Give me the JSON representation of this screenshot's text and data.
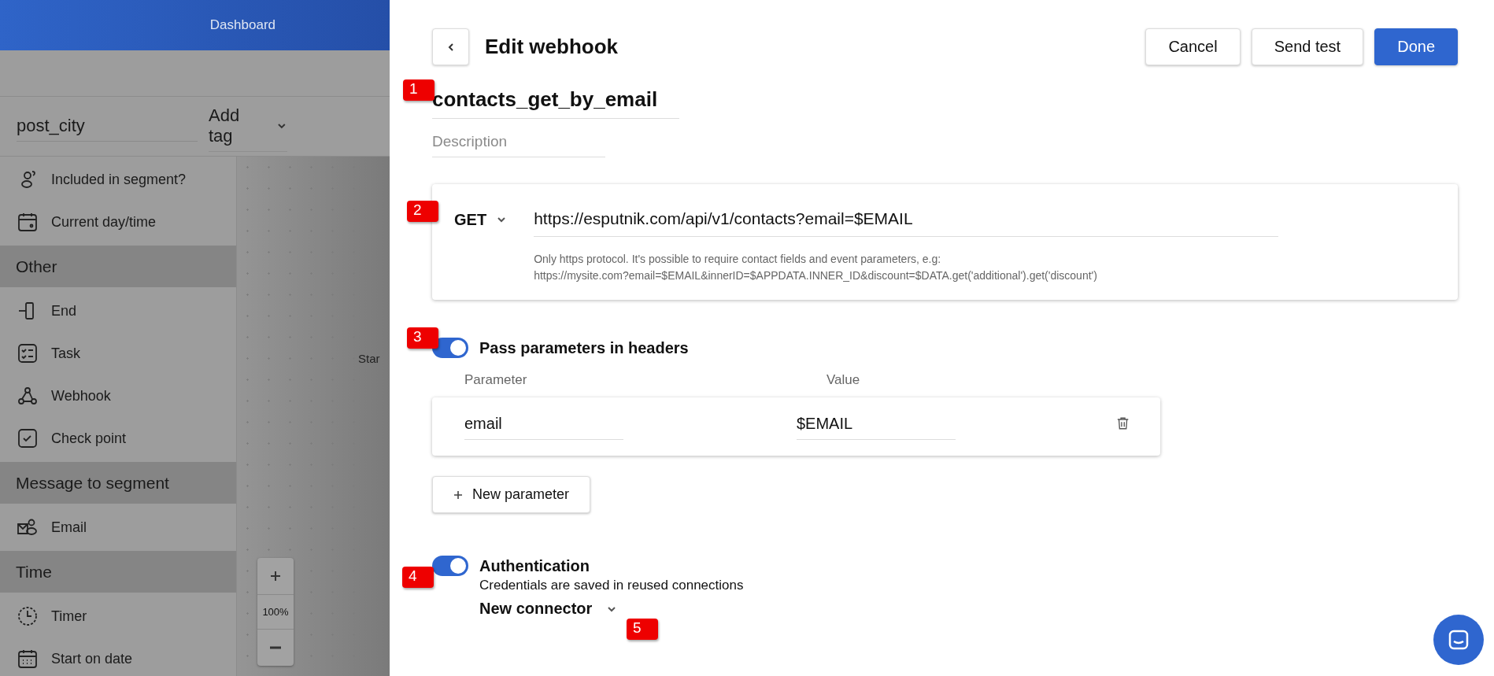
{
  "nav": {
    "links": [
      "Dashboard"
    ]
  },
  "toolbar": {
    "name_field": "post_city",
    "tag_dropdown": "Add tag"
  },
  "sidebar": [
    {
      "kind": "item",
      "label": "Included in segment?"
    },
    {
      "kind": "item",
      "label": "Current day/time"
    },
    {
      "kind": "section",
      "label": "Other"
    },
    {
      "kind": "item",
      "label": "End"
    },
    {
      "kind": "item",
      "label": "Task"
    },
    {
      "kind": "item",
      "label": "Webhook"
    },
    {
      "kind": "item",
      "label": "Check point"
    },
    {
      "kind": "section",
      "label": "Message to segment"
    },
    {
      "kind": "item",
      "label": "Email"
    },
    {
      "kind": "section",
      "label": "Time"
    },
    {
      "kind": "item",
      "label": "Timer"
    },
    {
      "kind": "item",
      "label": "Start on date"
    }
  ],
  "canvas": {
    "node_label": "Star",
    "zoom_level": "100%"
  },
  "editor": {
    "title": "Edit webhook",
    "buttons": [
      {
        "label": "Cancel",
        "kind": "secondary"
      },
      {
        "label": "Send test",
        "kind": "secondary"
      },
      {
        "label": "Done",
        "kind": "primary"
      }
    ],
    "name": "contacts_get_by_email",
    "description_placeholder": "Description",
    "request": {
      "method": "GET",
      "url": "https://esputnik.com/api/v1/contacts?email=$EMAIL",
      "hint_lines": [
        "Only https protocol. It's possible to require contact fields and event parameters, e.g:",
        "https://mysite.com?email=$EMAIL&innerID=$APPDATA.INNER_ID&discount=$DATA.get('additional').get('discount')"
      ]
    },
    "headers": {
      "on": true,
      "label": "Pass parameters in headers",
      "columns": [
        "Parameter",
        "Value"
      ],
      "rows": [
        {
          "parameter": "email",
          "value": "$EMAIL"
        }
      ],
      "add_button": "New parameter"
    },
    "auth": {
      "on": true,
      "label": "Authentication",
      "note": "Credentials are saved in reused connections",
      "connector": "New connector"
    }
  },
  "callouts": [
    "1",
    "2",
    "3",
    "4",
    "5"
  ]
}
